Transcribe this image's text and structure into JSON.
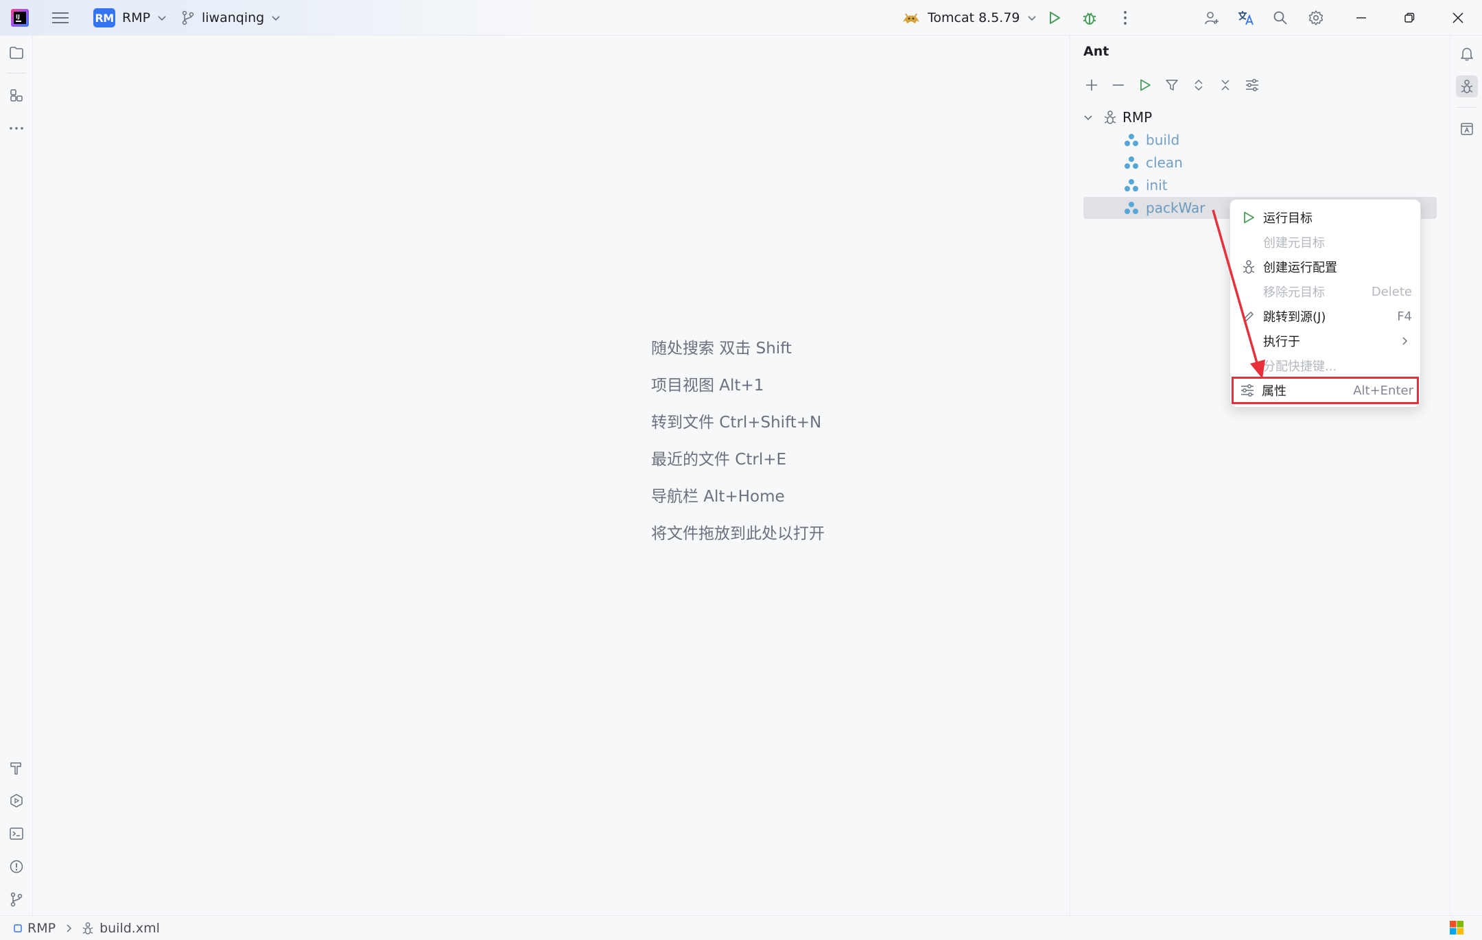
{
  "titlebar": {
    "project_badge": "RM",
    "project_name": "RMP",
    "branch": "liwanqing",
    "run_config": "Tomcat 8.5.79"
  },
  "editor": {
    "hints": [
      "随处搜索 双击 Shift",
      "项目视图 Alt+1",
      "转到文件 Ctrl+Shift+N",
      "最近的文件 Ctrl+E",
      "导航栏 Alt+Home",
      "将文件拖放到此处以打开"
    ]
  },
  "ant": {
    "title": "Ant",
    "root": "RMP",
    "targets": [
      "build",
      "clean",
      "init",
      "packWar"
    ]
  },
  "context_menu": {
    "items": [
      {
        "label": "运行目标",
        "shortcut": ""
      },
      {
        "label": "创建元目标",
        "shortcut": ""
      },
      {
        "label": "创建运行配置",
        "shortcut": ""
      },
      {
        "label": "移除元目标",
        "shortcut": "Delete"
      },
      {
        "label": "跳转到源(J)",
        "shortcut": "F4"
      },
      {
        "label": "执行于",
        "shortcut": ""
      },
      {
        "label": "分配快捷键...",
        "shortcut": ""
      },
      {
        "label": "属性",
        "shortcut": "Alt+Enter"
      }
    ]
  },
  "statusbar": {
    "project": "RMP",
    "file": "build.xml"
  },
  "colors": {
    "accent": "#3574f0",
    "run_green": "#4a9e5c",
    "highlight_red": "#e8303a",
    "target_blue": "#58a6d8"
  }
}
